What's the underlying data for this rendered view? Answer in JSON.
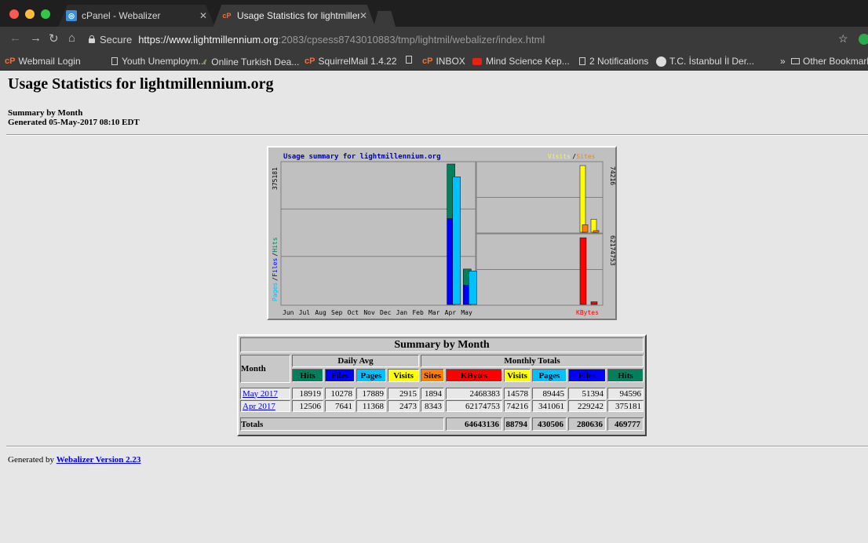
{
  "tabs": [
    {
      "title": "cPanel - Webalizer"
    },
    {
      "title": "Usage Statistics for lightmillen"
    }
  ],
  "toolbar": {
    "secure_label": "Secure",
    "url_scheme_host": "https://www.lightmillennium.org",
    "url_rest": ":2083/cpsess8743010883/tmp/lightmil/webalizer/index.html"
  },
  "bookmarks": [
    {
      "label": "Webmail Login",
      "icon": "cpanel-icon"
    },
    {
      "label": "Youth Unemploym...",
      "icon": "page-icon"
    },
    {
      "label": "Online Turkish Dea...",
      "icon": "leaf-icon"
    },
    {
      "label": "SquirrelMail 1.4.22",
      "icon": "cpanel-icon"
    },
    {
      "label": "",
      "icon": "page-icon"
    },
    {
      "label": "INBOX",
      "icon": "cpanel-icon"
    },
    {
      "label": "Mind Science Kep...",
      "icon": "youtube-icon"
    },
    {
      "label": "2 Notifications",
      "icon": "page-icon"
    },
    {
      "label": "T.C. İstanbul İl Der...",
      "icon": "seal-icon"
    },
    {
      "label": "»",
      "icon": ""
    },
    {
      "label": "Other Bookmarks",
      "icon": "folder-icon"
    }
  ],
  "page": {
    "title": "Usage Statistics for lightmillennium.org",
    "summary_line": "Summary by Month",
    "generated_line": "Generated 05-May-2017 08:10 EDT",
    "footer_prefix": "Generated by ",
    "footer_link": "Webalizer Version 2.23"
  },
  "chart_data": {
    "type": "bar",
    "title": "Usage summary for lightmillennium.org",
    "categories": [
      "Jun",
      "Jul",
      "Aug",
      "Sep",
      "Oct",
      "Nov",
      "Dec",
      "Jan",
      "Feb",
      "Mar",
      "Apr",
      "May"
    ],
    "left_panel": {
      "ylabel_parts": [
        "Pages",
        "/",
        "Files",
        "/",
        "Hits"
      ],
      "max_label": "375181",
      "max": 375181,
      "series": [
        {
          "name": "Hits",
          "color": "#00805c",
          "values": [
            0,
            0,
            0,
            0,
            0,
            0,
            0,
            0,
            0,
            0,
            375181,
            94596
          ]
        },
        {
          "name": "Files",
          "color": "#0000ff",
          "values": [
            0,
            0,
            0,
            0,
            0,
            0,
            0,
            0,
            0,
            0,
            229242,
            51394
          ]
        },
        {
          "name": "Pages",
          "color": "#00c0ff",
          "values": [
            0,
            0,
            0,
            0,
            0,
            0,
            0,
            0,
            0,
            0,
            341061,
            89445
          ]
        }
      ]
    },
    "right_top": {
      "legend_parts": [
        "Visits",
        "/",
        "Sites"
      ],
      "max_label": "74216",
      "max": 74216,
      "series": [
        {
          "name": "Visits",
          "color": "#ffff00",
          "values": [
            74216,
            14578
          ]
        },
        {
          "name": "Sites",
          "color": "#ff8000",
          "values": [
            8343,
            1894
          ]
        }
      ]
    },
    "right_bottom": {
      "legend": "KBytes",
      "max_label": "62174753",
      "max": 62174753,
      "series": [
        {
          "name": "KBytes",
          "color": "#ff0000",
          "values": [
            62174753,
            2468383
          ]
        }
      ]
    }
  },
  "summary_table": {
    "caption": "Summary by Month",
    "month_header": "Month",
    "daily_avg_header": "Daily Avg",
    "monthly_totals_header": "Monthly Totals",
    "columns": [
      {
        "label": "Hits",
        "bg": "#00805c",
        "fg": "#000000"
      },
      {
        "label": "Files",
        "bg": "#0000ff",
        "fg": "#000000"
      },
      {
        "label": "Pages",
        "bg": "#00c0ff",
        "fg": "#000000"
      },
      {
        "label": "Visits",
        "bg": "#ffff00",
        "fg": "#000000"
      },
      {
        "label": "Sites",
        "bg": "#ff8000",
        "fg": "#000000"
      },
      {
        "label": "KBytes",
        "bg": "#ff0000",
        "fg": "#000000"
      },
      {
        "label": "Visits",
        "bg": "#ffff00",
        "fg": "#000000"
      },
      {
        "label": "Pages",
        "bg": "#00c0ff",
        "fg": "#000000"
      },
      {
        "label": "Files",
        "bg": "#0000ff",
        "fg": "#000000"
      },
      {
        "label": "Hits",
        "bg": "#00805c",
        "fg": "#000000"
      }
    ],
    "rows": [
      {
        "month": "May 2017",
        "values": [
          "18919",
          "10278",
          "17889",
          "2915",
          "1894",
          "2468383",
          "14578",
          "89445",
          "51394",
          "94596"
        ]
      },
      {
        "month": "Apr 2017",
        "values": [
          "12506",
          "7641",
          "11368",
          "2473",
          "8343",
          "62174753",
          "74216",
          "341061",
          "229242",
          "375181"
        ]
      }
    ],
    "totals_label": "Totals",
    "totals": [
      "64643136",
      "88794",
      "430506",
      "280636",
      "469777"
    ]
  }
}
